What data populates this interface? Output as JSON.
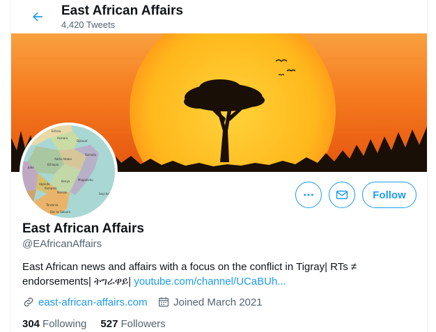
{
  "header": {
    "title": "East African Affairs",
    "tweet_count": "4,420 Tweets"
  },
  "avatar_map_labels": [
    "Eritrea",
    "Asmara",
    "Djibouti",
    "Somalia",
    "Addis Ababa",
    "Ethiopia",
    "Juba",
    "Uganda",
    "Kampala",
    "Kenya",
    "Nairobi",
    "Mogadishu",
    "Tanzania",
    "Dar es Salaam",
    "Seychel"
  ],
  "actions": {
    "more_label": "More",
    "message_label": "Message",
    "follow_label": "Follow"
  },
  "profile": {
    "name": "East African Affairs",
    "handle": "@EAfricanAffairs",
    "bio_text": "East African news and affairs with a focus on the conflict in Tigray| RTs ≠ endorsements| ትግራዋይ| ",
    "bio_link": "youtube.com/channel/UCaBUh...",
    "website": "east-african-affairs.com",
    "joined": "Joined March 2021"
  },
  "stats": {
    "following_count": "304",
    "following_label": "Following",
    "followers_count": "527",
    "followers_label": "Followers"
  },
  "colors": {
    "accent": "#1d9bf0",
    "text_primary": "#0f1419",
    "text_secondary": "#536471",
    "sunset_orange": "#f4711c",
    "sun_yellow": "#ffb81c"
  }
}
